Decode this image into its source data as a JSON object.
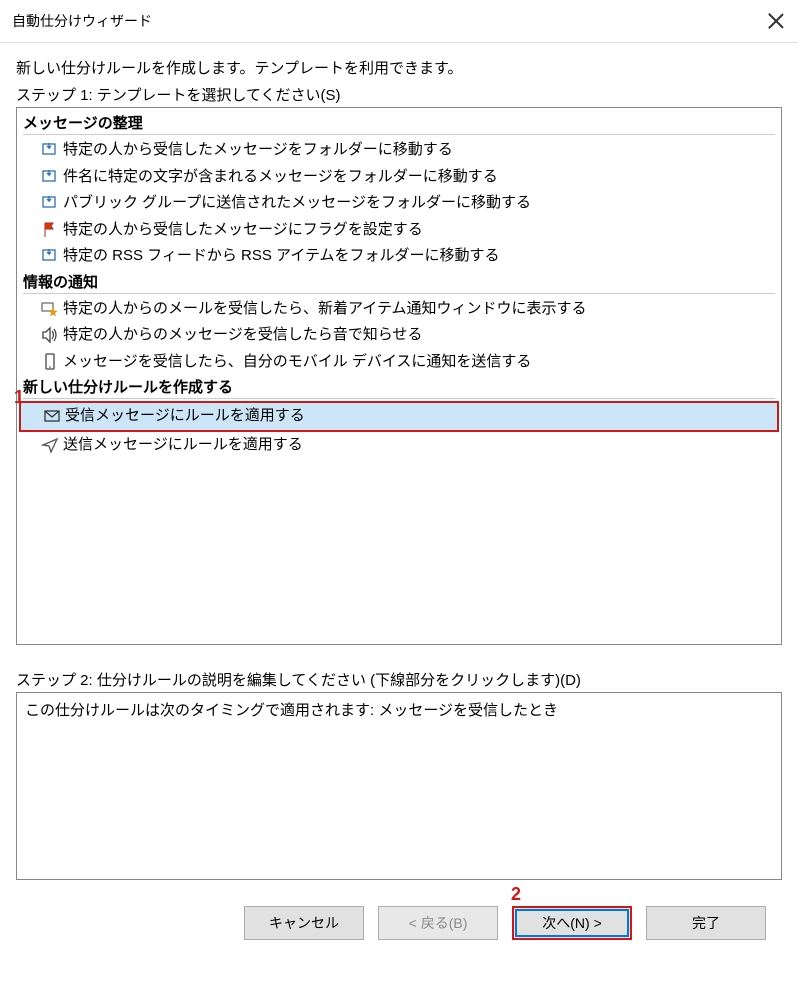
{
  "window": {
    "title": "自動仕分けウィザード"
  },
  "intro_text": "新しい仕分けルールを作成します。テンプレートを利用できます。",
  "step1_label": "ステップ 1: テンプレートを選択してください(S)",
  "sections": {
    "organize": {
      "header": "メッセージの整理",
      "items": [
        {
          "label": "特定の人から受信したメッセージをフォルダーに移動する",
          "icon": "move-folder-icon"
        },
        {
          "label": "件名に特定の文字が含まれるメッセージをフォルダーに移動する",
          "icon": "move-folder-icon"
        },
        {
          "label": "パブリック グループに送信されたメッセージをフォルダーに移動する",
          "icon": "move-folder-icon"
        },
        {
          "label": "特定の人から受信したメッセージにフラグを設定する",
          "icon": "flag-icon"
        },
        {
          "label": "特定の RSS フィードから RSS アイテムをフォルダーに移動する",
          "icon": "move-folder-icon"
        }
      ]
    },
    "notify": {
      "header": "情報の通知",
      "items": [
        {
          "label": "特定の人からのメールを受信したら、新着アイテム通知ウィンドウに表示する",
          "icon": "alert-star-icon"
        },
        {
          "label": "特定の人からのメッセージを受信したら音で知らせる",
          "icon": "sound-icon"
        },
        {
          "label": "メッセージを受信したら、自分のモバイル デバイスに通知を送信する",
          "icon": "mobile-icon"
        }
      ]
    },
    "create": {
      "header": "新しい仕分けルールを作成する",
      "items": [
        {
          "label": "受信メッセージにルールを適用する",
          "icon": "envelope-icon",
          "selected": true
        },
        {
          "label": "送信メッセージにルールを適用する",
          "icon": "send-icon"
        }
      ]
    }
  },
  "step2_label": "ステップ 2: 仕分けルールの説明を編集してください (下線部分をクリックします)(D)",
  "description_text": "この仕分けルールは次のタイミングで適用されます: メッセージを受信したとき",
  "buttons": {
    "cancel": "キャンセル",
    "back": "< 戻る(B)",
    "next": "次へ(N) >",
    "finish": "完了"
  },
  "annotations": {
    "a1": "1",
    "a2": "2"
  }
}
